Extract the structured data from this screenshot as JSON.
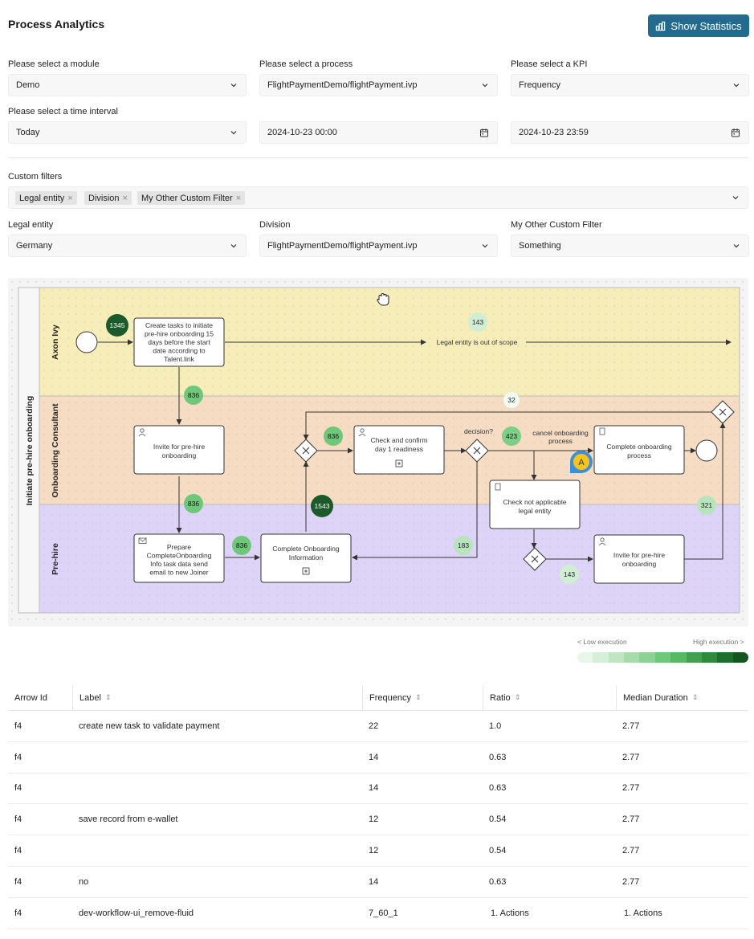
{
  "page_title": "Process Analytics",
  "stats_button": "Show Statistics",
  "filters": {
    "module": {
      "label": "Please select a module",
      "value": "Demo"
    },
    "process": {
      "label": "Please select a process",
      "value": "FlightPaymentDemo/flightPayment.ivp"
    },
    "kpi": {
      "label": "Please select a KPI",
      "value": "Frequency"
    },
    "time_interval": {
      "label": "Please select a time interval",
      "value": "Today"
    },
    "start": "2024-10-23 00:00",
    "end": "2024-10-23 23:59"
  },
  "custom_filters": {
    "label": "Custom filters",
    "chips": [
      "Legal entity",
      "Division",
      "My Other Custom Filter"
    ],
    "legal_entity": {
      "label": "Legal entity",
      "value": "Germany"
    },
    "division": {
      "label": "Division",
      "value": "FlightPaymentDemo/flightPayment.ivp"
    },
    "other": {
      "label": "My Other Custom Filter",
      "value": "Something"
    }
  },
  "diagram": {
    "pool": "Initiate pre-hire onboarding",
    "lanes": [
      "Axon Ivy",
      "Onboarding Consultant",
      "Pre-hire"
    ],
    "lane_colors": [
      "#f7edb9",
      "#f5dcc3",
      "#ddd4f8"
    ],
    "tasks": {
      "create_tasks": [
        "Create tasks to initiate",
        "pre-hire onboarding 15",
        "days before the start",
        "date according to",
        "Talent.link"
      ],
      "invite_consultant": [
        "Invite for pre-hire",
        "onboarding"
      ],
      "check_confirm": [
        "Check and confirm",
        "day 1 readiness"
      ],
      "complete_process": [
        "Complete onboarding",
        "process"
      ],
      "check_not_applicable": [
        "Check not applicable",
        "legal entity"
      ],
      "prepare": [
        "Prepare",
        "CompleteOnboarding",
        "Info task data send",
        "email to new Joiner"
      ],
      "complete_info": [
        "Complete Onboarding",
        "Information"
      ],
      "invite_prehire": [
        "Invite for pre-hire",
        "onboarding"
      ]
    },
    "edge_labels": {
      "out_of_scope": "Legal entity is out of scope",
      "decision": "decision?",
      "cancel": [
        "cancel onboarding",
        "process"
      ]
    },
    "badges": {
      "b1345": "1345",
      "b143_top": "143",
      "b836_a": "836",
      "b32": "32",
      "b836_b": "836",
      "b423": "423",
      "b836_c": "836",
      "b1543": "1543",
      "b836_d": "836",
      "b183": "183",
      "b321": "321",
      "b143_bottom": "143"
    },
    "cursor_avatar": "A"
  },
  "legend": {
    "low": "< Low execution",
    "high": "High execution >",
    "scale_colors": [
      "#e9f6ea",
      "#d6efd8",
      "#bfe6c3",
      "#a6dcab",
      "#8cd293",
      "#6fc77a",
      "#58b963",
      "#43a04e",
      "#2f8a3b",
      "#1f6f2c",
      "#13561f"
    ]
  },
  "table": {
    "headers": [
      "Arrow Id",
      "Label",
      "Frequency",
      "Ratio",
      "Median Duration"
    ],
    "rows": [
      [
        "f4",
        "create new task to validate payment",
        "22",
        "1.0",
        "2.77"
      ],
      [
        "f4",
        "",
        "14",
        "0.63",
        "2.77"
      ],
      [
        "f4",
        "",
        "14",
        "0.63",
        "2.77"
      ],
      [
        "f4",
        "save record from e-wallet",
        "12",
        "0.54",
        "2.77"
      ],
      [
        "f4",
        "",
        "12",
        "0.54",
        "2.77"
      ],
      [
        "f4",
        "no",
        "14",
        "0.63",
        "2.77"
      ],
      [
        "f4",
        "dev-workflow-ui_remove-fluid",
        "7_60_1",
        "1. Actions",
        "1. Actions"
      ]
    ]
  }
}
